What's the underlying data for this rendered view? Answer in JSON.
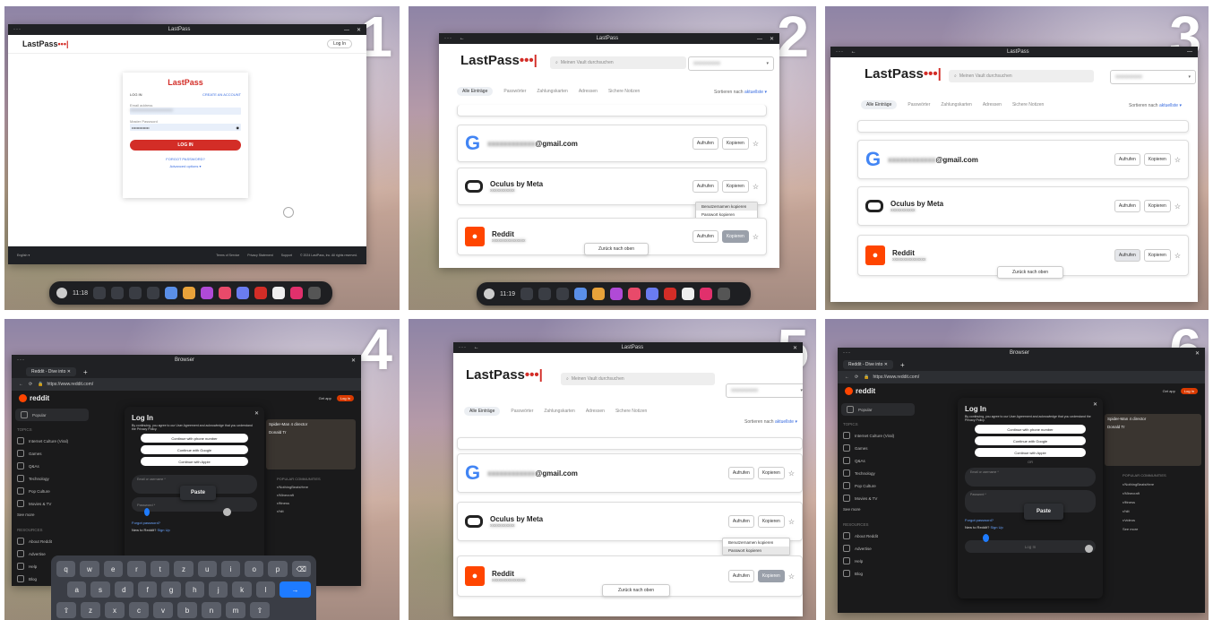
{
  "panels": {
    "p1": {
      "number": "1"
    },
    "p2": {
      "number": "2"
    },
    "p3": {
      "number": "3"
    },
    "p4": {
      "number": "4"
    },
    "p5": {
      "number": "5"
    },
    "p6": {
      "number": "6"
    }
  },
  "window": {
    "lastpass_title": "LastPass",
    "browser_title": "Browser",
    "close_glyph": "✕",
    "minimize_glyph": "—",
    "more_glyph": "···",
    "back_glyph": "←"
  },
  "login": {
    "logo_text": "LastPass",
    "logo_dots": "•••|",
    "header_login_button": "Log In",
    "tab_login": "LOG IN",
    "tab_create": "CREATE AN ACCOUNT",
    "email_label": "Email address",
    "password_label": "Master Password",
    "password_mask": "••••••••••••••",
    "submit": "LOG IN",
    "forgot": "FORGOT PASSWORD?",
    "advanced": "Advanced options ▾",
    "language": "English ▾",
    "footer_terms": "Terms of Service",
    "footer_privacy": "Privacy Statement",
    "footer_support": "Support",
    "footer_copyright": "© 2024 LastPass, Inc. All rights reserved."
  },
  "vault": {
    "logo_text": "LastPass",
    "logo_dots": "•••|",
    "search_placeholder": "Meinen Vault durchsuchen",
    "account_chevron": "▾",
    "tabs": [
      "Alle Einträge",
      "Passwörter",
      "Zahlungskarten",
      "Adressen",
      "Sichere Notizen"
    ],
    "sort_label": "Sortieren nach",
    "sort_value": "aktuellste ▾",
    "entries": {
      "google": {
        "name_suffix": "@gmail.com",
        "icon": "G"
      },
      "oculus": {
        "name": "Oculus by Meta"
      },
      "reddit": {
        "name": "Reddit"
      }
    },
    "btn_open": "Aufrufen",
    "btn_copy": "Kopieren",
    "star": "☆",
    "back_to_top": "Zurück nach oben",
    "menu_copy_user": "Benutzernamen kopieren",
    "menu_copy_pass": "Passwort kopieren"
  },
  "taskbar": {
    "time": "11:18"
  },
  "taskbar2": {
    "time": "11:19"
  },
  "reddit": {
    "tab_title": "Reddit - Dive into",
    "url": "https://www.reddit.com/",
    "logo": "reddit",
    "get_app": "Get app",
    "login_btn": "Log In",
    "popular": "Popular",
    "topics_header": "TOPICS",
    "topics": [
      "Internet Culture (Viral)",
      "Games",
      "Q&As",
      "Technology",
      "Pop Culture",
      "Movies & TV"
    ],
    "see_more": "See more",
    "resources_header": "RESOURCES",
    "resources": [
      "About Reddit",
      "Advertise",
      "Help",
      "Blog"
    ],
    "modal_title": "Log In",
    "modal_terms": "By continuing, you agree to our User Agreement and acknowledge that you understand the Privacy Policy.",
    "continue_phone": "Continue with phone number",
    "continue_google": "Continue with Google",
    "continue_apple": "Continue with Apple",
    "or": "OR",
    "email_placeholder": "Email or username *",
    "password_placeholder": "Password *",
    "forgot": "Forgot password?",
    "new_to_reddit": "New to Reddit?",
    "sign_up": "Sign Up",
    "submit": "Log In",
    "paste": "Paste",
    "popular_communities": "POPULAR COMMUNITIES",
    "communities": [
      "r/NothingBeatsHere",
      "r/Minecraft",
      "r/fitness",
      "r/hiit",
      "r/videos"
    ],
    "see_more_right": "See more",
    "card_title": "Spider-Man 4 director",
    "card_name": "James Earl",
    "card_right": "Donald Tr"
  },
  "keyboard": {
    "row1": [
      "q",
      "w",
      "e",
      "r",
      "t",
      "z",
      "u",
      "i",
      "o",
      "p",
      "⌫"
    ],
    "row2": [
      "a",
      "s",
      "d",
      "f",
      "g",
      "h",
      "j",
      "k",
      "l",
      "→"
    ],
    "row3": [
      "⇧",
      "z",
      "x",
      "c",
      "v",
      "b",
      "n",
      "m",
      "⇧"
    ]
  }
}
